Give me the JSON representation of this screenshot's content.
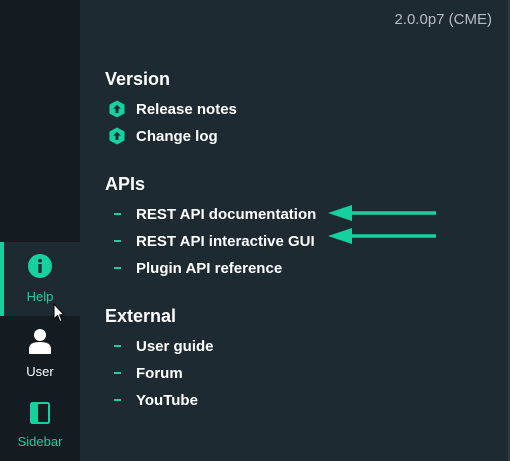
{
  "header": {
    "version": "2.0.0p7 (CME)"
  },
  "sections": [
    {
      "title": "Version",
      "items": [
        {
          "label": "Release notes",
          "icon": "checkmk-logo-icon"
        },
        {
          "label": "Change log",
          "icon": "checkmk-logo-icon"
        }
      ]
    },
    {
      "title": "APIs",
      "items": [
        {
          "label": "REST API documentation",
          "icon": "dash-icon"
        },
        {
          "label": "REST API interactive GUI",
          "icon": "dash-icon"
        },
        {
          "label": "Plugin API reference",
          "icon": "dash-icon"
        }
      ]
    },
    {
      "title": "External",
      "items": [
        {
          "label": "User guide",
          "icon": "dash-icon"
        },
        {
          "label": "Forum",
          "icon": "dash-icon"
        },
        {
          "label": "YouTube",
          "icon": "dash-icon"
        }
      ]
    }
  ],
  "nav": {
    "help": {
      "label": "Help",
      "icon": "info-icon",
      "active": true
    },
    "user": {
      "label": "User",
      "icon": "user-icon"
    },
    "sidebar": {
      "label": "Sidebar",
      "icon": "sidebar-icon"
    }
  },
  "annotations": {
    "arrow_color": "#15d1a0"
  },
  "colors": {
    "accent": "#15d1a0",
    "panel": "#1e2a31",
    "rail": "#141c21",
    "text": "#ffffff",
    "muted": "#b4bcc0"
  }
}
